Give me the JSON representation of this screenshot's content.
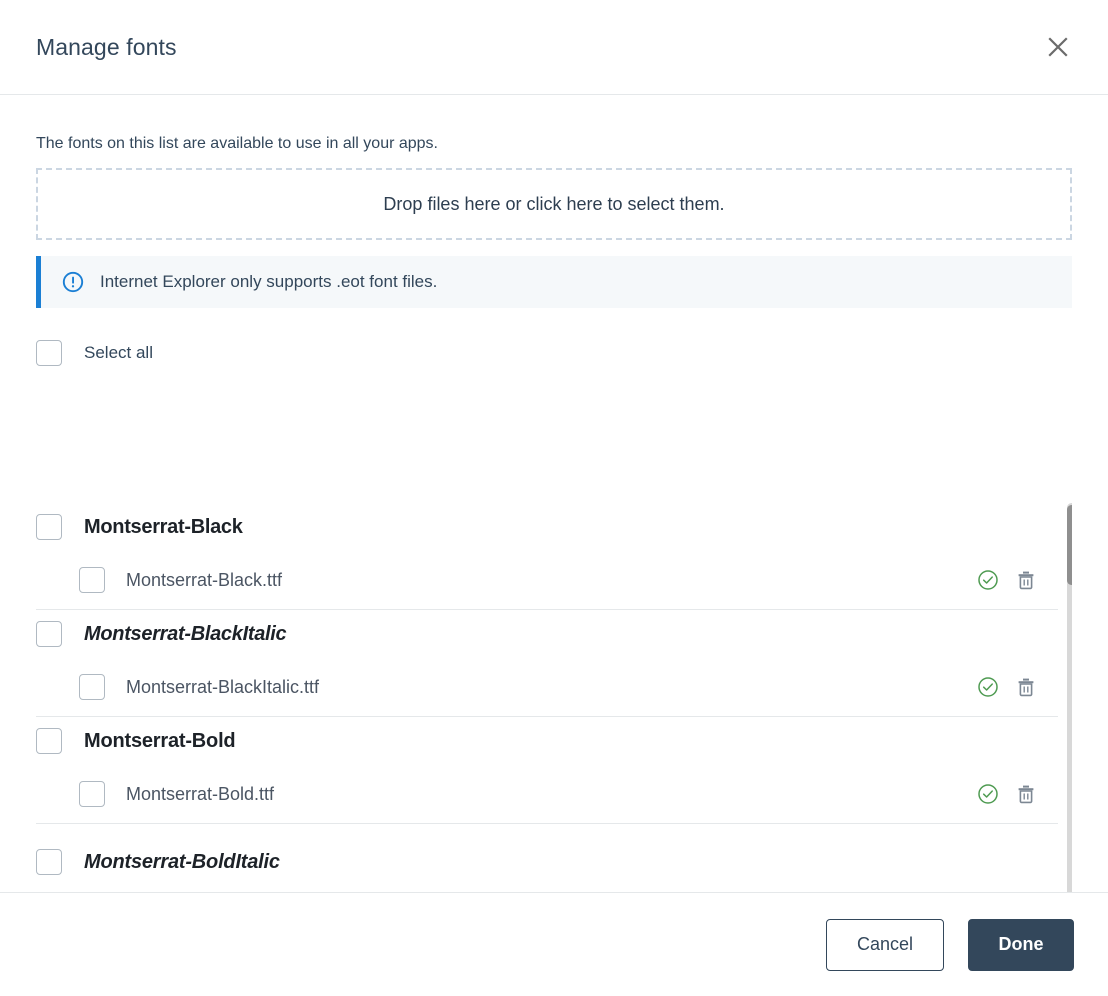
{
  "dialog": {
    "title": "Manage fonts",
    "close_icon": "close-icon"
  },
  "body": {
    "intro_text": "The fonts on this list are available to use in all your apps.",
    "dropzone_text": "Drop files here or click here to select them.",
    "info_banner": {
      "icon": "info-circle-icon",
      "text": "Internet Explorer only supports .eot font files.",
      "accent_color": "#1b7fd4",
      "background_color": "#f5f8fa"
    },
    "select_all_label": "Select all"
  },
  "font_groups": [
    {
      "name": "Montserrat-Black",
      "style": "black",
      "files": [
        {
          "name": "Montserrat-Black.ttf",
          "status_icon": "check-circle-icon",
          "delete_icon": "trash-icon"
        }
      ]
    },
    {
      "name": "Montserrat-BlackItalic",
      "style": "black italic",
      "files": [
        {
          "name": "Montserrat-BlackItalic.ttf",
          "status_icon": "check-circle-icon",
          "delete_icon": "trash-icon"
        }
      ]
    },
    {
      "name": "Montserrat-Bold",
      "style": "bold",
      "files": [
        {
          "name": "Montserrat-Bold.ttf",
          "status_icon": "check-circle-icon",
          "delete_icon": "trash-icon"
        }
      ]
    },
    {
      "name": "Montserrat-BoldItalic",
      "style": "bold italic",
      "files": []
    }
  ],
  "footer": {
    "cancel_label": "Cancel",
    "done_label": "Done",
    "primary_color": "#33475b"
  },
  "colors": {
    "success_green": "#4f9b52",
    "icon_gray": "#7c8793",
    "divider": "#e5e8ea"
  }
}
